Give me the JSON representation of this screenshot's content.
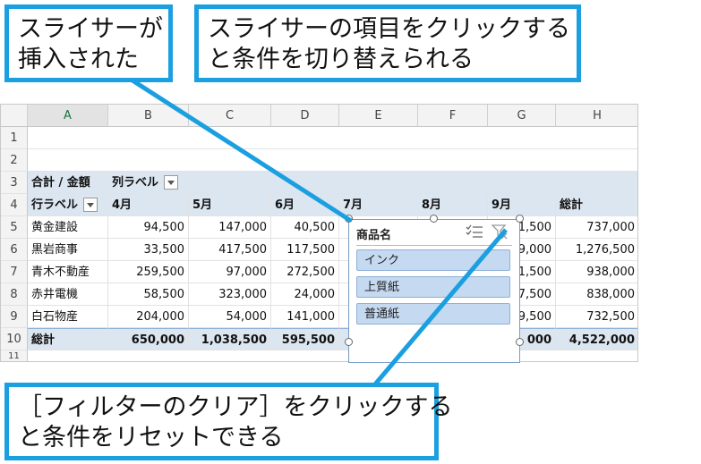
{
  "callouts": {
    "slicer_inserted": "スライサーが\n挿入された",
    "click_item": "スライサーの項目をクリックする\nと条件を切り替えられる",
    "clear_filter": "［フィルターのクリア］をクリックする\nと条件をリセットできる"
  },
  "columns": [
    "A",
    "B",
    "C",
    "D",
    "E",
    "F",
    "G",
    "H"
  ],
  "row_numbers": [
    "1",
    "2",
    "3",
    "4",
    "5",
    "6",
    "7",
    "8",
    "9",
    "10",
    "11"
  ],
  "pivot": {
    "sum_label": "合計 / 金額",
    "col_label": "列ラベル",
    "row_label": "行ラベル",
    "months": [
      "4月",
      "5月",
      "6月",
      "7月",
      "8月",
      "9月"
    ],
    "total_header": "総計",
    "rows": [
      {
        "name": "黄金建設",
        "b": "94,500",
        "c": "147,000",
        "d": "40,500",
        "g": "1,500",
        "h": "737,000"
      },
      {
        "name": "黒岩商事",
        "b": "33,500",
        "c": "417,500",
        "d": "117,500",
        "g": "9,000",
        "h": "1,276,500"
      },
      {
        "name": "青木不動産",
        "b": "259,500",
        "c": "97,000",
        "d": "272,500",
        "g": "1,500",
        "h": "938,000"
      },
      {
        "name": "赤井電機",
        "b": "58,500",
        "c": "323,000",
        "d": "24,000",
        "g": "7,500",
        "h": "838,000"
      },
      {
        "name": "白石物産",
        "b": "204,000",
        "c": "54,000",
        "d": "141,000",
        "g": "9,500",
        "h": "732,500"
      }
    ],
    "total": {
      "name": "総計",
      "b": "650,000",
      "c": "1,038,500",
      "d": "595,500",
      "g": "000",
      "h": "4,522,000"
    }
  },
  "slicer": {
    "title": "商品名",
    "items": [
      "インク",
      "上質紙",
      "普通紙"
    ],
    "colors": {
      "item_bg": "#c5d9f1",
      "border": "#7a9cc6"
    }
  },
  "colors": {
    "accent": "#1a9fe0",
    "band": "#dce6f1"
  }
}
